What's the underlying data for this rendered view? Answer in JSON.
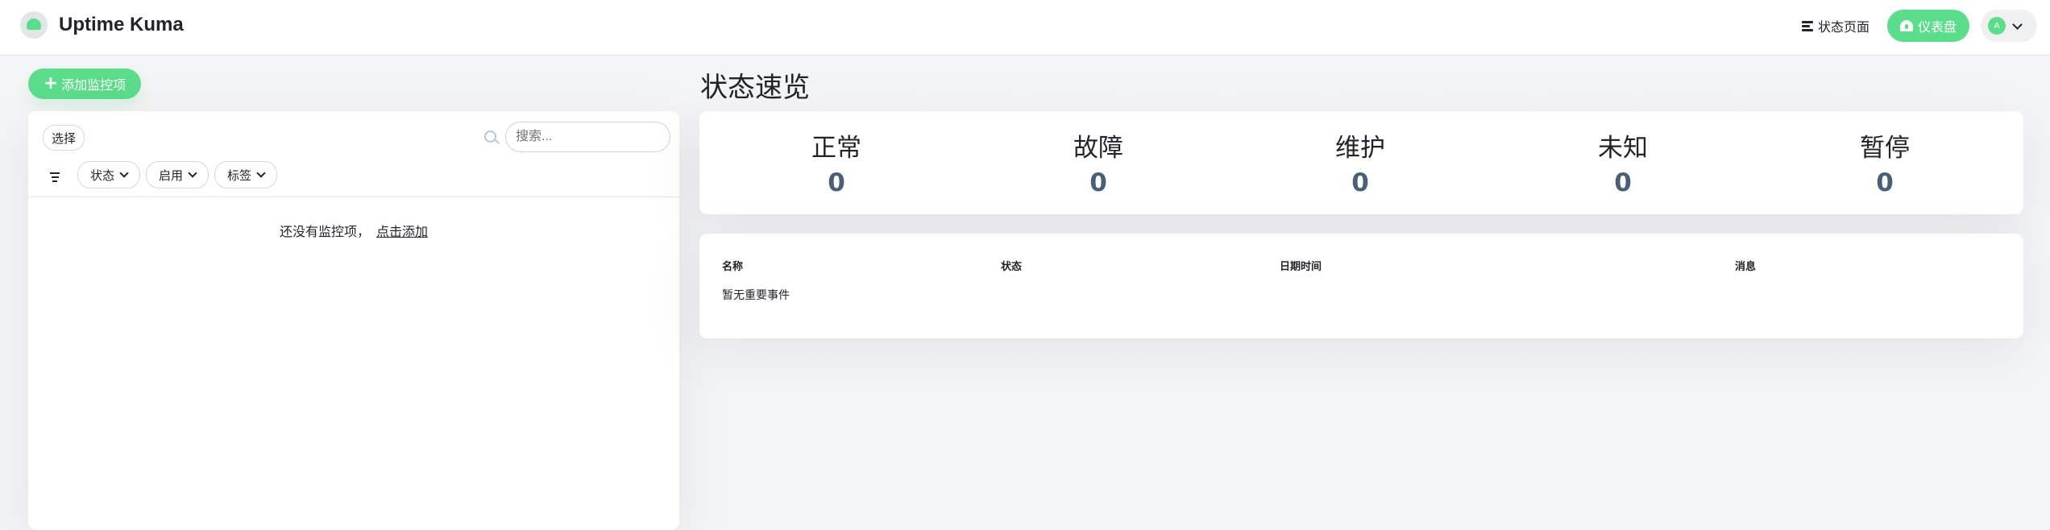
{
  "app": {
    "name": "Uptime Kuma"
  },
  "nav": {
    "status_page": "状态页面",
    "dashboard": "仪表盘",
    "avatar_initial": "A"
  },
  "sidebar": {
    "add_button": "添加监控项",
    "select_button": "选择",
    "search_placeholder": "搜索...",
    "filters": [
      "状态",
      "启用",
      "标签"
    ],
    "empty_text": "还没有监控项，",
    "empty_link": "点击添加"
  },
  "main": {
    "title": "状态速览",
    "stats": [
      {
        "label": "正常",
        "value": "0"
      },
      {
        "label": "故障",
        "value": "0"
      },
      {
        "label": "维护",
        "value": "0"
      },
      {
        "label": "未知",
        "value": "0"
      },
      {
        "label": "暂停",
        "value": "0"
      }
    ],
    "events": {
      "columns": [
        "名称",
        "状态",
        "日期时间",
        "消息"
      ],
      "empty": "暂无重要事件"
    }
  },
  "colors": {
    "accent": "#5cdd8b",
    "stat_value": "#4a5e76",
    "background": "#f4f5f6"
  }
}
